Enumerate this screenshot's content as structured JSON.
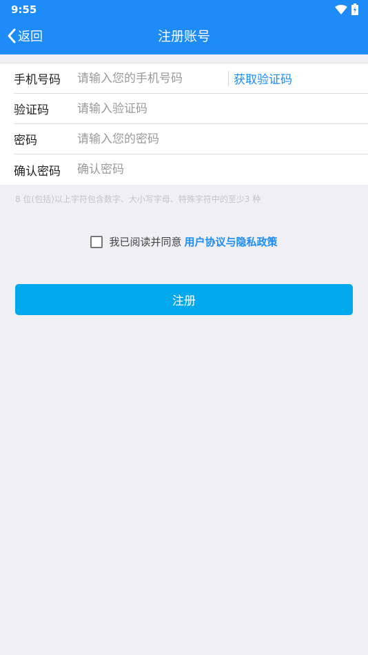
{
  "status_bar": {
    "time": "9:55"
  },
  "header": {
    "back_label": "返回",
    "title": "注册账号"
  },
  "form": {
    "phone": {
      "label": "手机号码",
      "placeholder": "请输入您的手机号码",
      "get_code_label": "获取验证码"
    },
    "code": {
      "label": "验证码",
      "placeholder": "请输入验证码"
    },
    "password": {
      "label": "密码",
      "placeholder": "请输入您的密码"
    },
    "confirm": {
      "label": "确认密码",
      "placeholder": "确认密码"
    }
  },
  "hint": "8 位(包括)以上字符包含数字、大小写字母、特殊字符中的至少3 种",
  "agreement": {
    "text": "我已阅读并同意",
    "link": "用户协议与隐私政策"
  },
  "register_label": "注册",
  "colors": {
    "header": "#1e8cf8",
    "button": "#01a8ec",
    "link": "#1e8cf8"
  }
}
